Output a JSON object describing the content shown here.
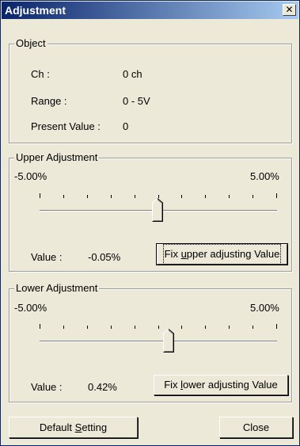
{
  "window": {
    "title": "Adjustment",
    "close_label": "✕"
  },
  "object": {
    "title": "Object",
    "rows": [
      {
        "label": "Ch :",
        "value": "0 ch"
      },
      {
        "label": "Range :",
        "value": "0 - 5V"
      },
      {
        "label": "Present Value :",
        "value": "0"
      }
    ]
  },
  "upper": {
    "title": "Upper Adjustment",
    "min_label": "-5.00%",
    "max_label": "5.00%",
    "value_label": "Value :",
    "value": "-0.05%",
    "button_pre": "Fix ",
    "button_key": "u",
    "button_post": "pper adjusting Value",
    "slider_min": -5.0,
    "slider_max": 5.0,
    "slider_value": -0.05
  },
  "lower": {
    "title": "Lower Adjustment",
    "min_label": "-5.00%",
    "max_label": "5.00%",
    "value_label": "Value :",
    "value": "0.42%",
    "button_pre": "Fix ",
    "button_key": "l",
    "button_post": "ower adjusting Value",
    "slider_min": -5.0,
    "slider_max": 5.0,
    "slider_value": 0.42
  },
  "footer": {
    "default_pre": "Default ",
    "default_key": "S",
    "default_post": "etting",
    "close_label": "Close"
  }
}
